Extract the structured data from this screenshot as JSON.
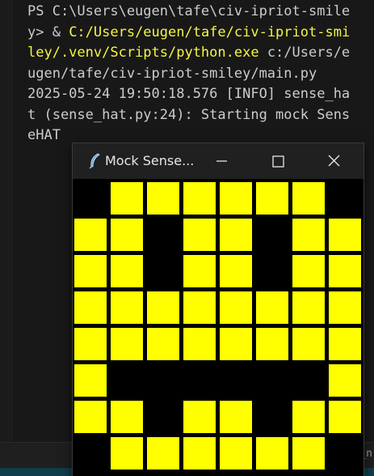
{
  "terminal": {
    "lines": [
      {
        "parts": [
          {
            "text": "PS C:\\Users\\eugen\\tafe\\civ-ipriot-smile",
            "color": "default"
          }
        ]
      },
      {
        "parts": [
          {
            "text": "y> & ",
            "color": "default"
          },
          {
            "text": "C:/Users/eugen/tafe/civ-ipriot-smi",
            "color": "yellow"
          }
        ]
      },
      {
        "parts": [
          {
            "text": "ley/.venv/Scripts/python.exe",
            "color": "yellow"
          },
          {
            "text": " c:/Users/e",
            "color": "default"
          }
        ]
      },
      {
        "parts": [
          {
            "text": "ugen/tafe/civ-ipriot-smiley/main.py",
            "color": "default"
          }
        ]
      },
      {
        "parts": [
          {
            "text": "2025-05-24 19:50:18.576 [INFO] sense_ha",
            "color": "default"
          }
        ]
      },
      {
        "parts": [
          {
            "text": "t (sense_hat.py:24): Starting mock Sens",
            "color": "default"
          }
        ]
      },
      {
        "parts": [
          {
            "text": "eHAT",
            "color": "default"
          }
        ]
      }
    ]
  },
  "bottom_panel": {
    "partial_text": "_n"
  },
  "window": {
    "title": "Mock Sense...",
    "icon": "feather-icon",
    "buttons": [
      "minimize-icon",
      "maximize-icon",
      "close-icon"
    ]
  },
  "led_matrix": {
    "colors": {
      "Y": "#ffff00",
      "K": "#000000"
    },
    "rows": [
      "KYYYYYYK",
      "YYKYYKYY",
      "YYKYYKYY",
      "YYYYYYYY",
      "YYYYYYYY",
      "YKKKKKKY",
      "YYKYYKYY",
      "KYYYYYYK"
    ]
  }
}
